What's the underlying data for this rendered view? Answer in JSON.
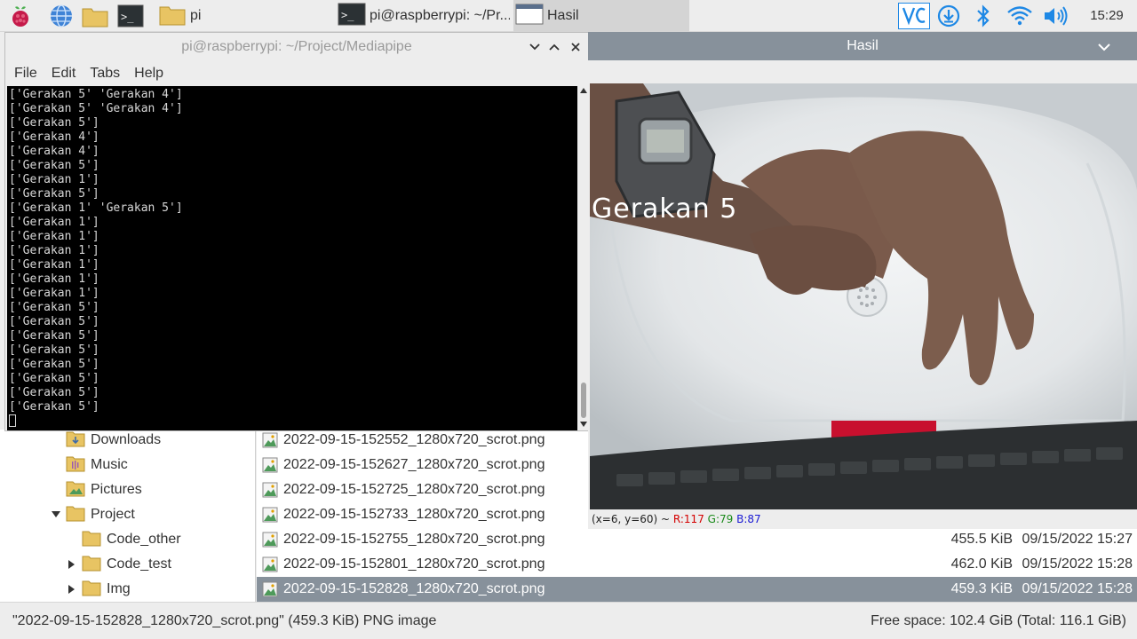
{
  "taskbar": {
    "tasks": [
      {
        "label": "pi"
      },
      {
        "label": "pi@raspberrypi: ~/Pr..."
      },
      {
        "label": "Hasil"
      }
    ],
    "clock": "15:29"
  },
  "terminal": {
    "title": "pi@raspberrypi: ~/Project/Mediapipe",
    "menu": [
      "File",
      "Edit",
      "Tabs",
      "Help"
    ],
    "lines": [
      "['Gerakan 5' 'Gerakan 4']",
      "['Gerakan 5' 'Gerakan 4']",
      "['Gerakan 5']",
      "['Gerakan 4']",
      "['Gerakan 4']",
      "['Gerakan 5']",
      "['Gerakan 1']",
      "['Gerakan 5']",
      "['Gerakan 1' 'Gerakan 5']",
      "['Gerakan 1']",
      "['Gerakan 1']",
      "['Gerakan 1']",
      "['Gerakan 1']",
      "['Gerakan 1']",
      "['Gerakan 1']",
      "['Gerakan 5']",
      "['Gerakan 5']",
      "['Gerakan 5']",
      "['Gerakan 5']",
      "['Gerakan 5']",
      "['Gerakan 5']",
      "['Gerakan 5']",
      "['Gerakan 5']"
    ]
  },
  "hasil": {
    "title": "Hasil",
    "overlay_label": "Gerakan 5",
    "status": {
      "coords": "(x=6, y=60) ~ ",
      "r": "R:117",
      "g": "G:79",
      "b": "B:87"
    }
  },
  "file_manager": {
    "tree": [
      {
        "label": "Downloads",
        "icon": "downloads-folder-icon"
      },
      {
        "label": "Music",
        "icon": "music-folder-icon"
      },
      {
        "label": "Pictures",
        "icon": "pictures-folder-icon"
      },
      {
        "label": "Project",
        "icon": "folder-icon",
        "expanded": true
      },
      {
        "label": "Code_other",
        "icon": "folder-icon"
      },
      {
        "label": "Code_test",
        "icon": "folder-icon"
      },
      {
        "label": "Img",
        "icon": "folder-icon"
      }
    ],
    "files": [
      {
        "name": "2022-09-15-152552_1280x720_scrot.png",
        "size": "",
        "date": ""
      },
      {
        "name": "2022-09-15-152627_1280x720_scrot.png",
        "size": "",
        "date": ""
      },
      {
        "name": "2022-09-15-152725_1280x720_scrot.png",
        "size": "",
        "date": ""
      },
      {
        "name": "2022-09-15-152733_1280x720_scrot.png",
        "size": "",
        "date": ""
      },
      {
        "name": "2022-09-15-152755_1280x720_scrot.png",
        "size": "455.5 KiB",
        "date": "09/15/2022 15:27"
      },
      {
        "name": "2022-09-15-152801_1280x720_scrot.png",
        "size": "462.0 KiB",
        "date": "09/15/2022 15:28"
      },
      {
        "name": "2022-09-15-152828_1280x720_scrot.png",
        "size": "459.3 KiB",
        "date": "09/15/2022 15:28",
        "selected": true
      }
    ],
    "status_left": "\"2022-09-15-152828_1280x720_scrot.png\" (459.3 KiB) PNG image",
    "status_right": "Free space: 102.4 GiB (Total: 116.1 GiB)"
  },
  "colors": {
    "accent_titlebar": "#87919b",
    "terminal_bg": "#000000",
    "terminal_fg": "#d7d7d7",
    "vnc_blue": "#1e88e5"
  }
}
